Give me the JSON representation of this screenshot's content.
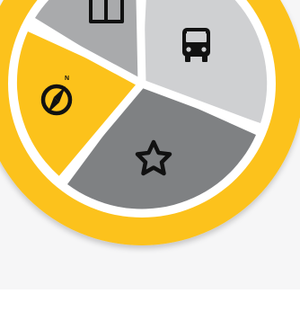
{
  "colors": {
    "background_top": "#f6f6f7",
    "background_bottom": "#ffffff",
    "ring_yellow": "#fcc21b",
    "ring_border": "#ffffff",
    "slice_top_left_gray": "#a9aaac",
    "slice_right_light_gray": "#cfd0d2",
    "slice_bottom_dark_gray": "#7f8183",
    "slice_left_yellow": "#fcc21b",
    "icon": "#111111"
  },
  "logo": {
    "slices": [
      {
        "name": "book",
        "icon": "book-icon",
        "color": "#a9aaac"
      },
      {
        "name": "bus",
        "icon": "bus-icon",
        "color": "#cfd0d2"
      },
      {
        "name": "star",
        "icon": "star-icon",
        "color": "#7f8183"
      },
      {
        "name": "compass",
        "icon": "compass-icon",
        "color": "#fcc21b",
        "compass_label": "N"
      }
    ]
  }
}
